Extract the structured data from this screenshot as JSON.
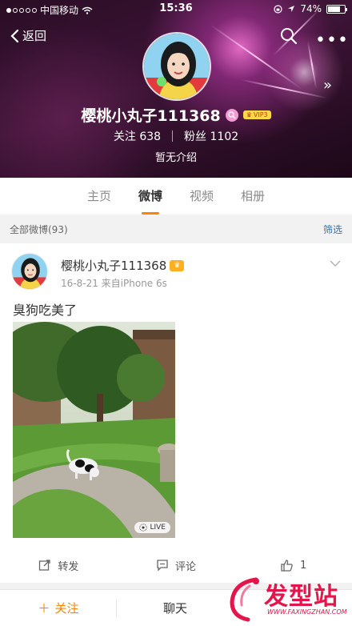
{
  "status_bar": {
    "carrier": "中国移动",
    "time": "15:36",
    "battery": "74%",
    "battery_level": 0.74
  },
  "nav": {
    "back_label": "返回",
    "search_icon": "search-icon",
    "more_icon": "more-icon",
    "expand_icon": "double-chevron-right-icon"
  },
  "profile": {
    "name": "樱桃小丸子111368",
    "vip_label": "VIP3",
    "following_label": "关注",
    "following_count": "638",
    "followers_label": "粉丝",
    "followers_count": "1102",
    "intro": "暂无介绍"
  },
  "tabs": [
    {
      "label": "主页",
      "active": false
    },
    {
      "label": "微博",
      "active": true
    },
    {
      "label": "视频",
      "active": false
    },
    {
      "label": "相册",
      "active": false
    }
  ],
  "filter": {
    "all_label": "全部微博(93)",
    "filter_label": "筛选"
  },
  "post": {
    "author": "樱桃小丸子111368",
    "date": "16-8-21",
    "source": "来自iPhone 6s",
    "text": "臭狗吃美了",
    "live_label": "LIVE"
  },
  "actions": {
    "repost": "转发",
    "comment": "评论",
    "like": "1"
  },
  "bottom_bar": {
    "follow": "关注",
    "chat": "聊天"
  },
  "watermark": {
    "text": "发型站",
    "url": "WWW.FAXINGZHAN.COM"
  },
  "colors": {
    "accent": "#ff8200",
    "link": "#3a6ea5",
    "watermark": "#e3154a"
  }
}
